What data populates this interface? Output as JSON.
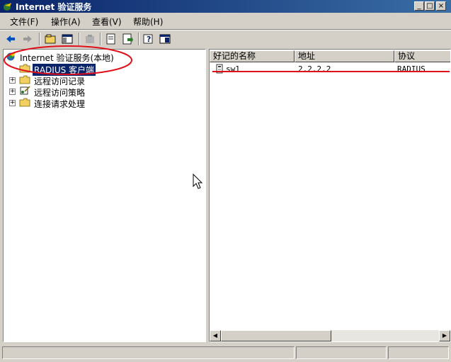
{
  "window": {
    "title": "Internet 验证服务"
  },
  "menu": [
    "文件(F)",
    "操作(A)",
    "查看(V)",
    "帮助(H)"
  ],
  "tree": {
    "root": "Internet 验证服务(本地)",
    "items": [
      "RADIUS 客户端",
      "远程访问记录",
      "远程访问策略",
      "连接请求处理"
    ]
  },
  "list": {
    "columns": [
      "好记的名称",
      "地址",
      "协议"
    ],
    "rows": [
      {
        "name": "sw1",
        "address": "2.2.2.2",
        "protocol": "RADIUS"
      }
    ]
  },
  "colors": {
    "title_bar": "#0a246a",
    "selection": "#0a246a",
    "annotation": "#e0101a",
    "face": "#d4d0c8"
  }
}
